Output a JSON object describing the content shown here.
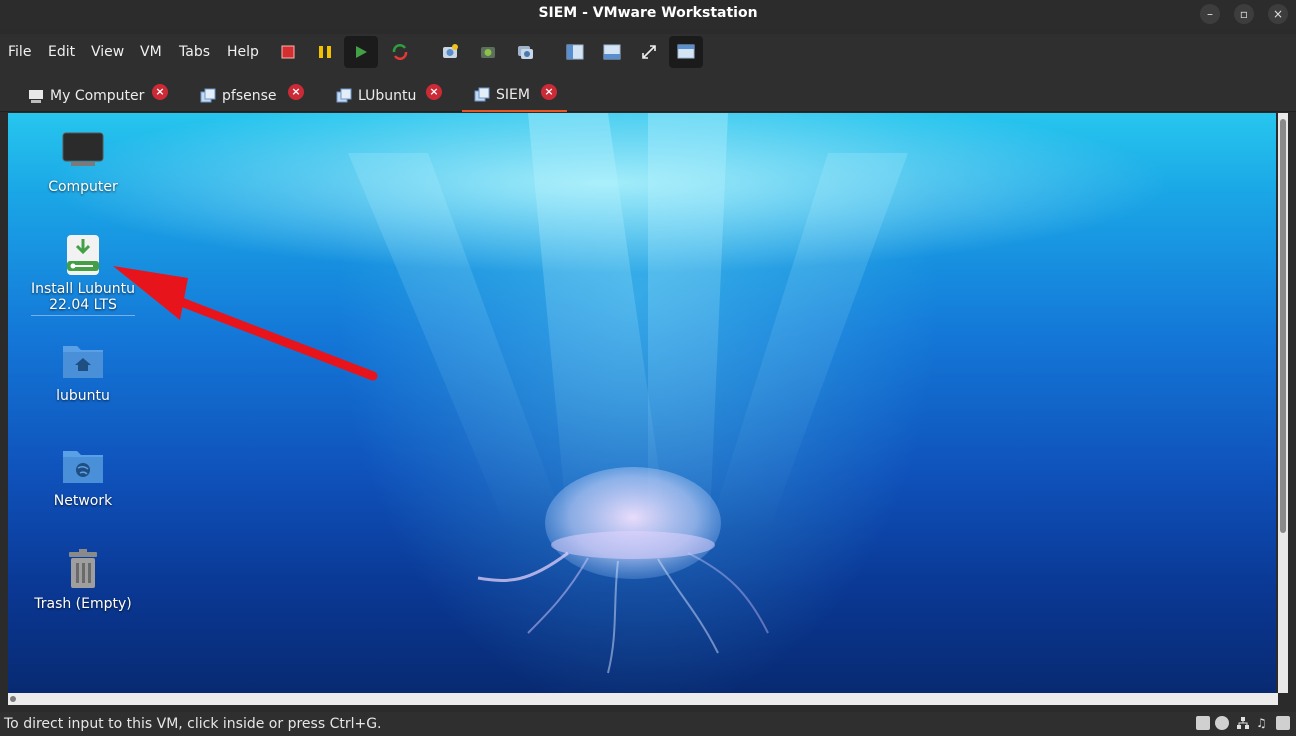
{
  "window": {
    "title": "SIEM - VMware Workstation"
  },
  "window_controls": {
    "minimize": "–",
    "maximize": "▫",
    "close": "×"
  },
  "menu": {
    "items": [
      "File",
      "Edit",
      "View",
      "VM",
      "Tabs",
      "Help"
    ]
  },
  "toolbar": {
    "buttons": [
      "power-off",
      "suspend",
      "power-on",
      "restart",
      "snapshot",
      "revert-snapshot",
      "snapshot-manager",
      "normal-view",
      "console-view",
      "fullscreen",
      "unity"
    ]
  },
  "tabs": [
    {
      "label": "My Computer",
      "icon": "computer-icon",
      "active": false
    },
    {
      "label": "pfsense",
      "icon": "vm-icon",
      "active": false
    },
    {
      "label": "LUbuntu",
      "icon": "vm-icon",
      "active": false
    },
    {
      "label": "SIEM",
      "icon": "vm-icon",
      "active": true
    }
  ],
  "desktop": {
    "icons": [
      {
        "label": "Computer",
        "icon": "monitor-icon"
      },
      {
        "label_line1": "Install Lubuntu",
        "label_line2": "22.04 LTS",
        "icon": "installer-icon",
        "selected": true
      },
      {
        "label": "lubuntu",
        "icon": "home-folder-icon"
      },
      {
        "label": "Network",
        "icon": "network-folder-icon"
      },
      {
        "label": "Trash (Empty)",
        "icon": "trash-icon"
      }
    ]
  },
  "annotation": {
    "type": "arrow",
    "color": "#e8141c"
  },
  "statusbar": {
    "text": "To direct input to this VM, click inside or press Ctrl+G."
  },
  "colors": {
    "accent": "#e95420",
    "tab_close": "#cc2a36",
    "power_off": "#d32f2f",
    "suspend": "#f2c200",
    "power_on": "#4caf50"
  }
}
